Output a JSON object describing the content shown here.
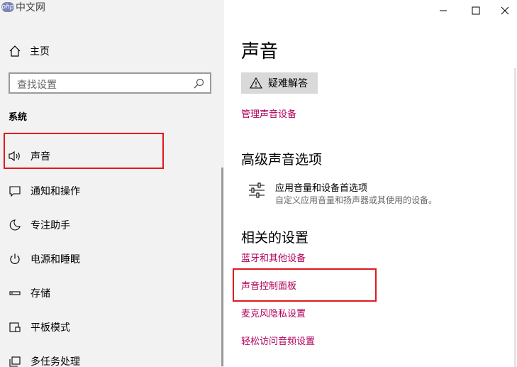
{
  "watermark": {
    "badge": "php",
    "text": "中文网"
  },
  "sidebar": {
    "home_label": "主页",
    "search_placeholder": "查找设置",
    "category": "系统",
    "items": [
      {
        "label": "声音",
        "icon": "speaker-icon"
      },
      {
        "label": "通知和操作",
        "icon": "message-icon"
      },
      {
        "label": "专注助手",
        "icon": "moon-icon"
      },
      {
        "label": "电源和睡眠",
        "icon": "power-icon"
      },
      {
        "label": "存储",
        "icon": "storage-icon"
      },
      {
        "label": "平板模式",
        "icon": "tablet-icon"
      },
      {
        "label": "多任务处理",
        "icon": "multitask-icon"
      }
    ]
  },
  "main": {
    "title": "声音",
    "troubleshoot_label": "疑难解答",
    "manage_devices_link": "管理声音设备",
    "advanced_heading": "高级声音选项",
    "app_volume_title": "应用音量和设备首选项",
    "app_volume_desc": "自定义应用音量和扬声器或其使用的设备。",
    "related_heading": "相关的设置",
    "related_links": [
      "蓝牙和其他设备",
      "声音控制面板",
      "麦克风隐私设置",
      "轻松访问音频设置"
    ]
  },
  "colors": {
    "link": "#b0005b",
    "highlight": "#e0191f",
    "sidebar_bg": "#f2f2f2"
  }
}
